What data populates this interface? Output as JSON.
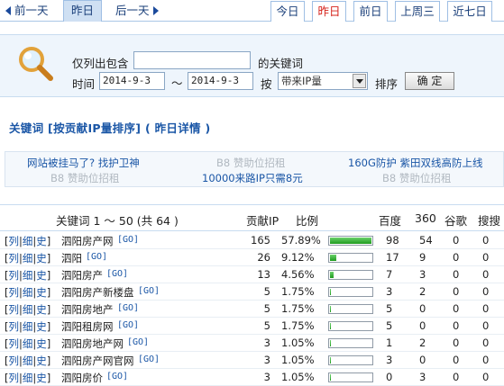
{
  "nav": {
    "prev_label": "前一天",
    "current_label": "昨日",
    "next_label": "后一天",
    "tabs": [
      "今日",
      "昨日",
      "前日",
      "上周三",
      "近七日"
    ],
    "active_tab": 1
  },
  "filter": {
    "include_label": "仅列出包含",
    "keyword_value": "",
    "keyword_suffix": "的关键词",
    "time_label": "时间",
    "date_from": "2014-9-3",
    "range_sep": "～",
    "date_to": "2014-9-3",
    "by_label": "按",
    "sort_select": "带来IP量",
    "sort_label": "排序",
    "confirm_label": "确 定"
  },
  "title": "关键词 [按贡献IP量排序] ( 昨日详情 )",
  "ads": {
    "left_top": "网站被挂马了? 找护卫神",
    "left_bottom": "B8 赞助位招租",
    "mid_top": "B8 赞助位招租",
    "mid_bottom": "10000来路IP只需8元",
    "right_top": "160G防护 紫田双线高防上线",
    "right_bottom": "B8 赞助位招租"
  },
  "table": {
    "headers": {
      "keyword": "关键词 1 ～ 50 (共 64 )",
      "ip": "贡献IP",
      "ratio": "比例",
      "baidu": "百度",
      "s360": "360",
      "google": "谷歌",
      "sogou": "搜搜"
    },
    "row_links": {
      "lie": "列",
      "xi": "细",
      "shi": "史"
    },
    "go_label": "[GO]",
    "rows": [
      {
        "keyword": "泗阳房产网",
        "ip": "165",
        "ratio": "57.89%",
        "ratio_value": 0.5789,
        "baidu": "98",
        "s360": "54",
        "google": "0",
        "sogou": "0"
      },
      {
        "keyword": "泗阳",
        "ip": "26",
        "ratio": "9.12%",
        "ratio_value": 0.0912,
        "baidu": "17",
        "s360": "9",
        "google": "0",
        "sogou": "0"
      },
      {
        "keyword": "泗阳房产",
        "ip": "13",
        "ratio": "4.56%",
        "ratio_value": 0.0456,
        "baidu": "7",
        "s360": "3",
        "google": "0",
        "sogou": "0"
      },
      {
        "keyword": "泗阳房产新楼盘",
        "ip": "5",
        "ratio": "1.75%",
        "ratio_value": 0.0175,
        "baidu": "3",
        "s360": "2",
        "google": "0",
        "sogou": "0"
      },
      {
        "keyword": "泗阳房地产",
        "ip": "5",
        "ratio": "1.75%",
        "ratio_value": 0.0175,
        "baidu": "5",
        "s360": "0",
        "google": "0",
        "sogou": "0"
      },
      {
        "keyword": "泗阳租房网",
        "ip": "5",
        "ratio": "1.75%",
        "ratio_value": 0.0175,
        "baidu": "5",
        "s360": "0",
        "google": "0",
        "sogou": "0"
      },
      {
        "keyword": "泗阳房地产网",
        "ip": "3",
        "ratio": "1.05%",
        "ratio_value": 0.0105,
        "baidu": "1",
        "s360": "2",
        "google": "0",
        "sogou": "0"
      },
      {
        "keyword": "泗阳房产网官网",
        "ip": "3",
        "ratio": "1.05%",
        "ratio_value": 0.0105,
        "baidu": "3",
        "s360": "0",
        "google": "0",
        "sogou": "0"
      },
      {
        "keyword": "泗阳房价",
        "ip": "3",
        "ratio": "1.05%",
        "ratio_value": 0.0105,
        "baidu": "0",
        "s360": "3",
        "google": "0",
        "sogou": "0"
      }
    ]
  }
}
